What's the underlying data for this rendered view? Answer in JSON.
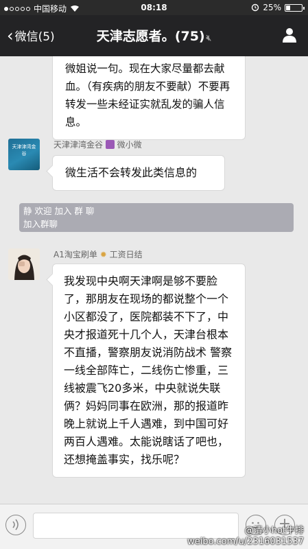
{
  "status_bar": {
    "carrier": "中国移动",
    "time": "08:18",
    "battery": "25%",
    "battery_level": 0.25
  },
  "nav": {
    "back_label": "微信(5)",
    "title": "天津志愿者。",
    "count": "(75)",
    "icons": [
      "back-chevron-icon",
      "mute-icon",
      "group-members-icon"
    ]
  },
  "messages": [
    {
      "text": "微姐说一句。现在大家尽量都去献血。（有疾病的朋友不要献）不要再转发一些未经证实就乱发的骗人信息。"
    },
    {
      "sender": "天津津湾金谷",
      "sender_tag": "微小微",
      "avatar_text": "天津津湾金谷",
      "text": "微生活不会转发此类信息的"
    },
    {
      "sender": "A1淘宝刷单",
      "sender_tag": "工资日结",
      "text": "我发现中央啊天津啊是够不要脸了，那朋友在现场的都说整个一个小区都没了，医院都装不下了，中央才报道死十几个人，天津台根本不直播，警察朋友说消防战术 警察一线全部阵亡，二线伤亡惨重，三线被震飞20多米，中央就说失联俩？妈妈同事在欧洲，那的报道昨晚上就说上千人遇难，到中国可好两百人遇难。太能说瞎话了吧也，还想掩盖事实，找乐呢？"
    }
  ],
  "system_notice": {
    "line1": "静 欢迎 加入 群 聊",
    "line2": "加入群聊"
  },
  "input_bar": {
    "icons": [
      "voice-icon",
      "emoji-icon",
      "plus-icon"
    ]
  },
  "watermark": {
    "handle": "@清小hot牛排",
    "url": "weibo.com/u/2316031537"
  }
}
